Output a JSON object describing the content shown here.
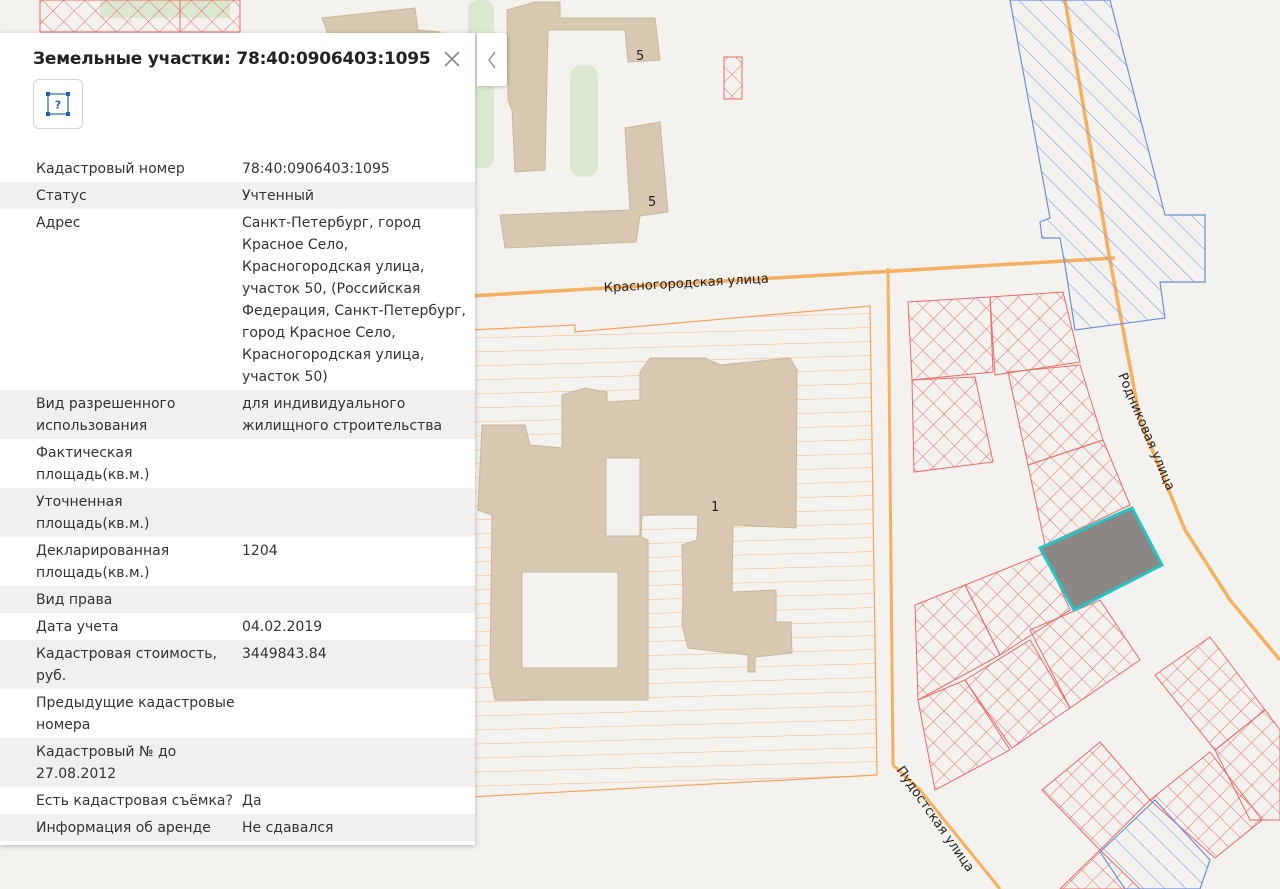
{
  "panel": {
    "title": "Земельные участки: 78:40:0906403:1095",
    "tool_icon_label": "?",
    "rows": [
      {
        "key": "Кадастровый номер",
        "value": "78:40:0906403:1095"
      },
      {
        "key": "Статус",
        "value": "Учтенный"
      },
      {
        "key": "Адрес",
        "value": "Санкт-Петербург, город Красное Село, Красногородская улица, участок 50, (Российская Федерация, Санкт-Петербург, город Красное Село, Красногородская улица, участок 50)"
      },
      {
        "key": "Вид разрешенного использования",
        "value": "для индивидуального жилищного строительства"
      },
      {
        "key": "Фактическая площадь(кв.м.)",
        "value": ""
      },
      {
        "key": "Уточненная площадь(кв.м.)",
        "value": ""
      },
      {
        "key": "Декларированная площадь(кв.м.)",
        "value": "1204"
      },
      {
        "key": "Вид права",
        "value": ""
      },
      {
        "key": "Дата учета",
        "value": "04.02.2019"
      },
      {
        "key": "Кадастровая стоимость, руб.",
        "value": "3449843.84"
      },
      {
        "key": "Предыдущие кадастровые номера",
        "value": ""
      },
      {
        "key": "Кадастровый № до 27.08.2012",
        "value": ""
      },
      {
        "key": "Есть кадастровая съёмка?",
        "value": "Да"
      },
      {
        "key": "Информация об аренде",
        "value": "Не сдавался"
      }
    ]
  },
  "map": {
    "streets": [
      "Красногородская улица",
      "Родниковая улица",
      "Пудостская улица"
    ],
    "building_numbers": [
      "5",
      "5",
      "1"
    ],
    "colors": {
      "parcel_red": "#e86a6a",
      "parcel_blue": "#6b8fdc",
      "parcel_orange": "#f5a35a",
      "building": "#d8c8b2",
      "road": "#f5b060",
      "green": "#dbe8cf",
      "selected_fill": "#8c8684",
      "selected_outline": "#27c4c4"
    }
  }
}
